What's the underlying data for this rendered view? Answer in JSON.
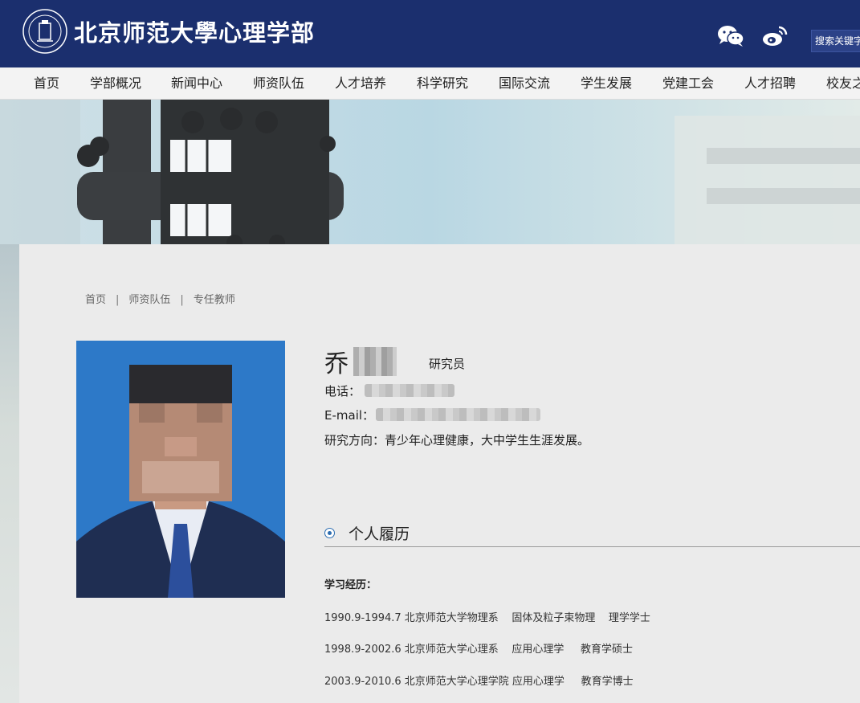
{
  "header": {
    "logo_text": "北京师范大學心理学部",
    "logo_seal_text": "FACULTY OF PSYCHOLOGY · BEIJING NORMAL UNIVERSITY",
    "search_placeholder": "搜索关键字",
    "brand_color": "#1b2f6e",
    "icons": [
      "wechat-icon",
      "weibo-icon"
    ]
  },
  "nav": {
    "items": [
      "首页",
      "学部概况",
      "新闻中心",
      "师资队伍",
      "人才培养",
      "科学研究",
      "国际交流",
      "学生发展",
      "党建工会",
      "人才招聘",
      "校友之家"
    ]
  },
  "breadcrumb": [
    "首页",
    "师资队伍",
    "专任教师"
  ],
  "profile": {
    "name": "乔",
    "title": "研究员",
    "phone_label": "电话：",
    "email_label": "E-mail：",
    "research_label": "研究方向：",
    "research_value": "青少年心理健康，大中学生生涯发展。"
  },
  "section": {
    "title": "个人履历",
    "study_label": "学习经历：",
    "education": [
      "1990.9-1994.7 北京师范大学物理系    固体及粒子束物理    理学学士",
      "1998.9-2002.6 北京师范大学心理系    应用心理学     教育学硕士",
      "2003.9-2010.6 北京师范大学心理学院 应用心理学     教育学博士"
    ]
  }
}
